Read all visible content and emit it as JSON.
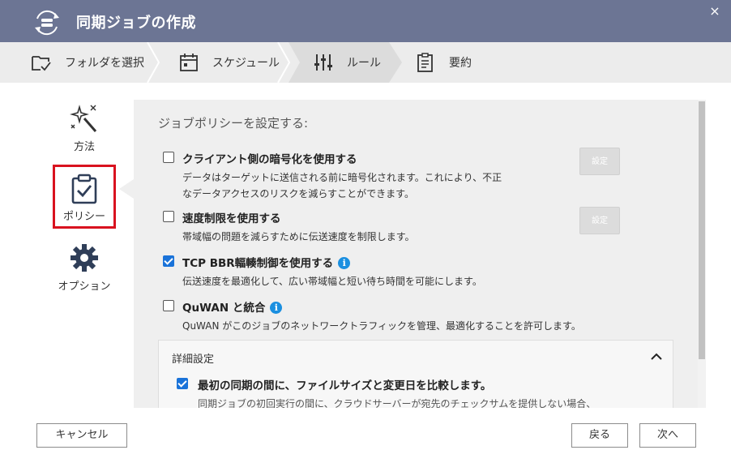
{
  "window": {
    "title": "同期ジョブの作成",
    "icon": "sync-icon",
    "close_label": "×"
  },
  "steps": [
    {
      "label": "フォルダを選択",
      "icon": "folder-select-icon",
      "active": false
    },
    {
      "label": "スケジュール",
      "icon": "calendar-icon",
      "active": false
    },
    {
      "label": "ルール",
      "icon": "sliders-icon",
      "active": true
    },
    {
      "label": "要約",
      "icon": "summary-icon",
      "active": false
    }
  ],
  "nav": {
    "method_label": "方法",
    "policy_label": "ポリシー",
    "options_label": "オプション"
  },
  "panel": {
    "heading": "ジョブポリシーを設定する:",
    "options": [
      {
        "title": "クライアント側の暗号化を使用する",
        "desc_line1": "データはターゲットに送信される前に暗号化されます。これにより、不正",
        "desc_line2": "なデータアクセスのリスクを減らすことができます。",
        "checked": false,
        "button": "設定"
      },
      {
        "title": "速度制限を使用する",
        "desc_line1": "帯域幅の問題を減らすために伝送速度を制限します。",
        "checked": false,
        "button": "設定"
      },
      {
        "title": "TCP BBR輻輳制御を使用する",
        "desc_line1": "伝送速度を最適化して、広い帯域幅と短い待ち時間を可能にします。",
        "checked": true
      },
      {
        "title": "QuWAN と統合",
        "desc_line1": "QuWAN がこのジョブのネットワークトラフィックを管理、最適化することを許可します。",
        "checked": false
      }
    ],
    "advanced": {
      "title": "詳細設定",
      "option_title": "最初の同期の間に、ファイルサイズと変更日を比較します。",
      "option_desc": "同期ジョブの初回実行の間に、クラウドサーバーが宛先のチェックサムを提供しない場合、",
      "checked": true
    }
  },
  "footer": {
    "cancel": "キャンセル",
    "back": "戻る",
    "next": "次へ"
  },
  "colors": {
    "titlebar": "#6c7594",
    "accent": "#1a73d9",
    "highlight": "#d9121f"
  }
}
